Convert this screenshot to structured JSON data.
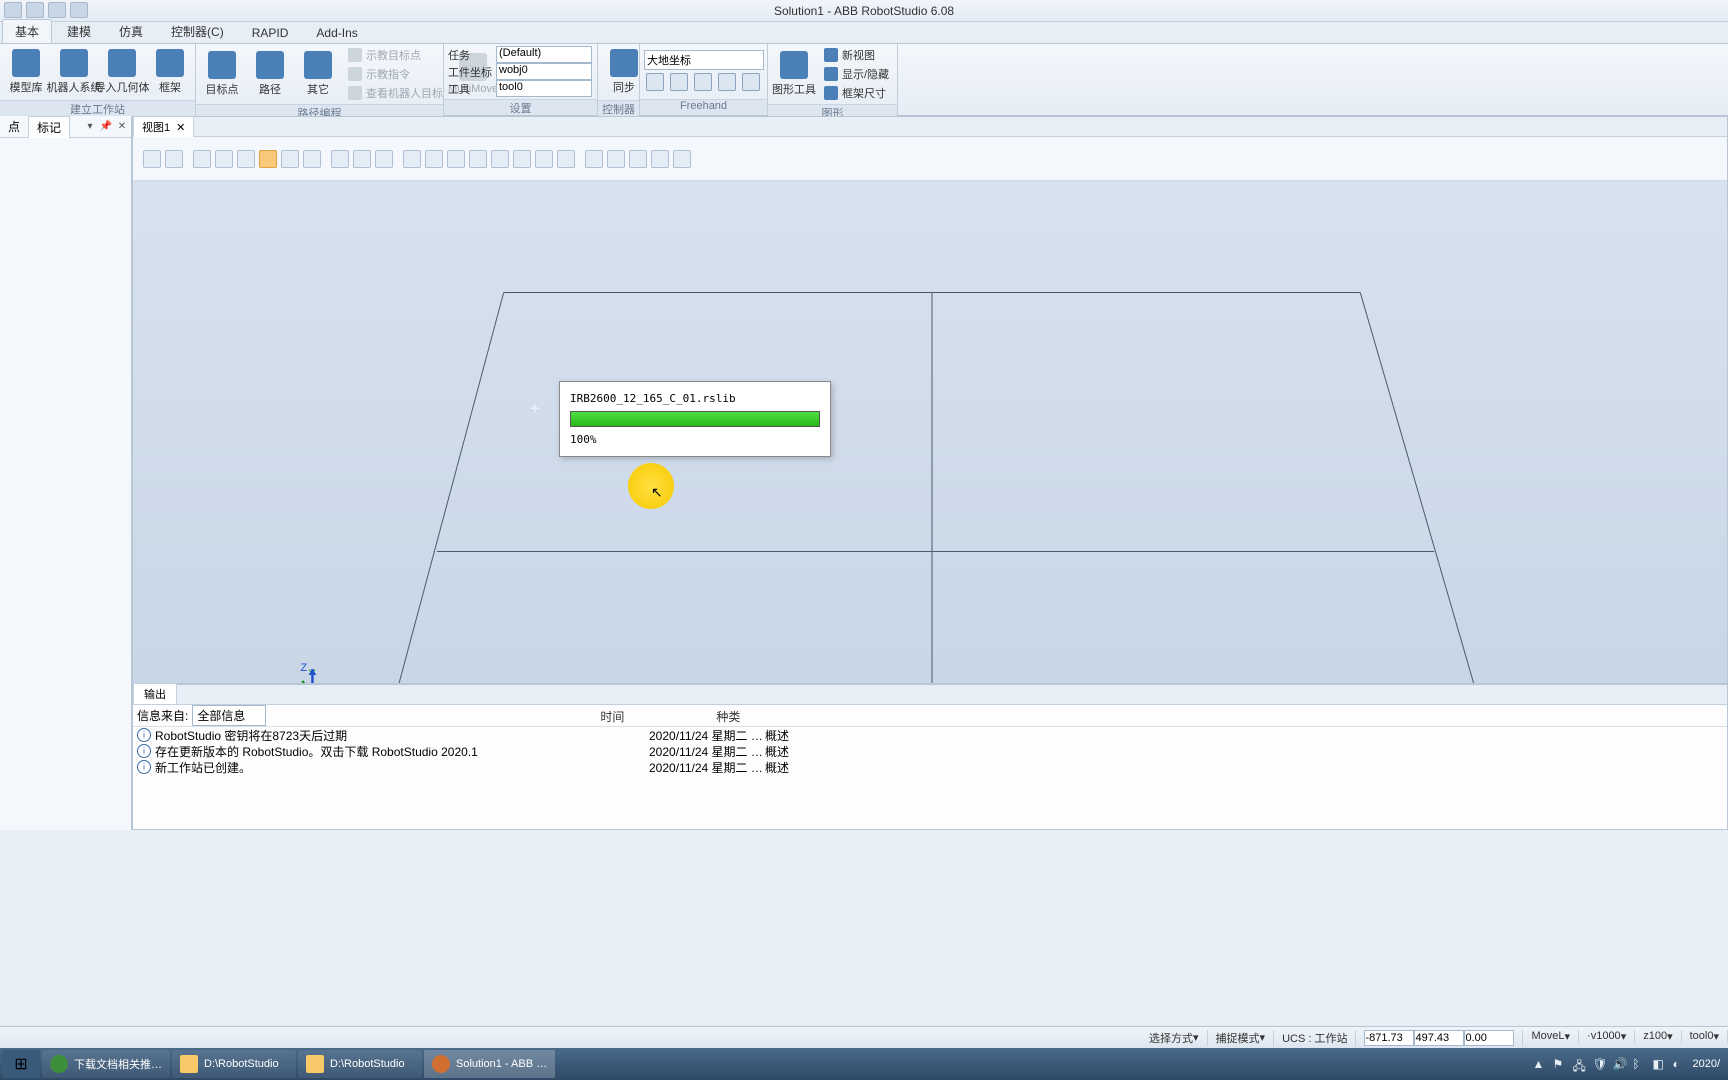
{
  "window": {
    "title": "Solution1 - ABB RobotStudio 6.08"
  },
  "tabs": {
    "t0": "基本",
    "t1": "建模",
    "t2": "仿真",
    "t3": "控制器(C)",
    "t4": "RAPID",
    "t5": "Add-Ins"
  },
  "ribbon": {
    "g1": {
      "b0": "模型库",
      "b1": "机器人系统",
      "b2": "导入几何体",
      "b3": "框架",
      "label": "建立工作站"
    },
    "g2": {
      "b0": "目标点",
      "b1": "路径",
      "b2": "其它",
      "s0": "示教目标点",
      "s1": "示教指令",
      "s2": "查看机器人目标",
      "mm": "MultiMove",
      "label": "路径编程"
    },
    "g3": {
      "r0": "任务",
      "r1": "工件坐标",
      "r2": "工具",
      "v0": "(Default)",
      "v1": "wobj0",
      "v2": "tool0",
      "label": "设置"
    },
    "g4": {
      "b0": "同步",
      "label": "控制器"
    },
    "g5": {
      "sel": "大地坐标",
      "label": "Freehand"
    },
    "g6": {
      "b0": "图形工具",
      "s0": "新视图",
      "s1": "显示/隐藏",
      "s2": "框架尺寸",
      "label": "图形"
    }
  },
  "left": {
    "t0": "点",
    "t1": "标记"
  },
  "view": {
    "tab": "视图1"
  },
  "dialog": {
    "file": "IRB2600_12_165_C_01.rslib",
    "pct": "100%"
  },
  "output": {
    "tab": "输出",
    "filter_label": "信息来自:",
    "filter_value": "全部信息",
    "h_source": "",
    "h_time": "时间",
    "h_cat": "种类",
    "rows": [
      {
        "msg": "RobotStudio 密钥将在8723天后过期",
        "time": "2020/11/24 星期二 …",
        "cat": "概述"
      },
      {
        "msg": "存在更新版本的 RobotStudio。双击下载 RobotStudio 2020.1",
        "time": "2020/11/24 星期二 …",
        "cat": "概述"
      },
      {
        "msg": "新工作站已创建。",
        "time": "2020/11/24 星期二 …",
        "cat": "概述"
      }
    ]
  },
  "status": {
    "sel": "选择方式",
    "cap": "捕捉模式",
    "ucs": "UCS : 工作站",
    "x": "-871.73",
    "y": "497.43",
    "z": "0.00",
    "move": "MoveL",
    "spd": "v1000",
    "zone": "z100",
    "tool": "tool0"
  },
  "taskbar": {
    "items": [
      {
        "label": "下载文档相关推…"
      },
      {
        "label": "D:\\RobotStudio"
      },
      {
        "label": "D:\\RobotStudio"
      },
      {
        "label": "Solution1 - ABB …"
      }
    ],
    "clock": "2020/"
  }
}
